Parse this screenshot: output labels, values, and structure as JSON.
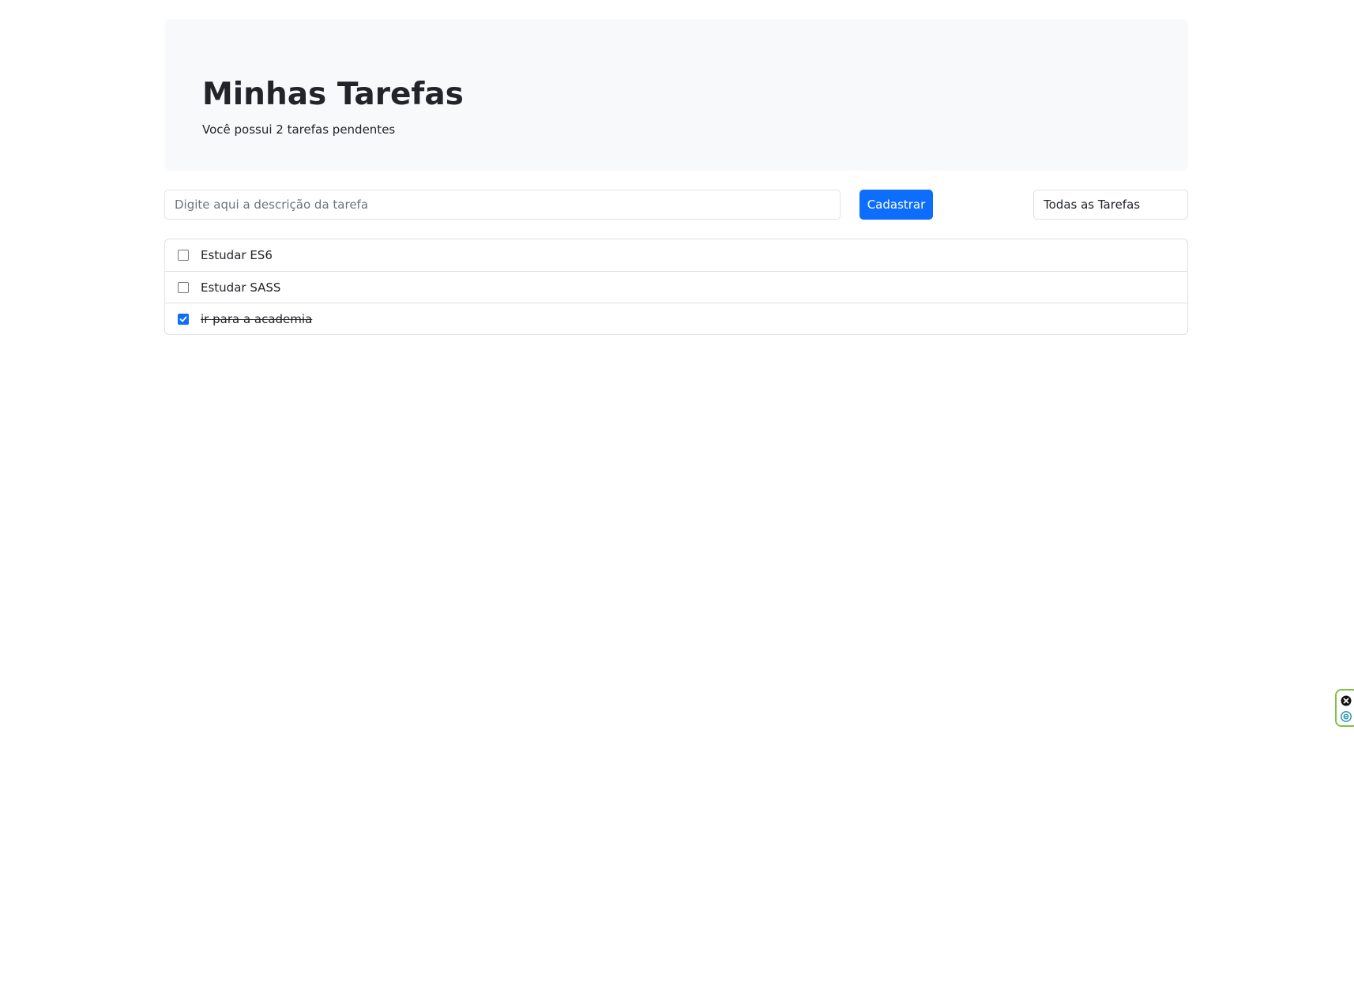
{
  "header": {
    "title": "Minhas Tarefas",
    "subtitle": "Você possui 2 tarefas pendentes"
  },
  "form": {
    "input_value": "",
    "input_placeholder": "Digite aqui a descrição da tarefa",
    "submit_label": "Cadastrar",
    "filter_selected": "Todas as Tarefas"
  },
  "tasks": [
    {
      "label": "Estudar ES6",
      "done": false
    },
    {
      "label": "Estudar SASS",
      "done": false
    },
    {
      "label": "ir para a academia",
      "done": true
    }
  ],
  "extension": {
    "icons": [
      "close-circle-icon",
      "e-logo-icon"
    ]
  },
  "colors": {
    "primary": "#0d6efd",
    "jumbotron_bg": "#f8f9fa",
    "border": "#dee2e6",
    "text": "#212529",
    "extension_border": "#7cc242"
  }
}
